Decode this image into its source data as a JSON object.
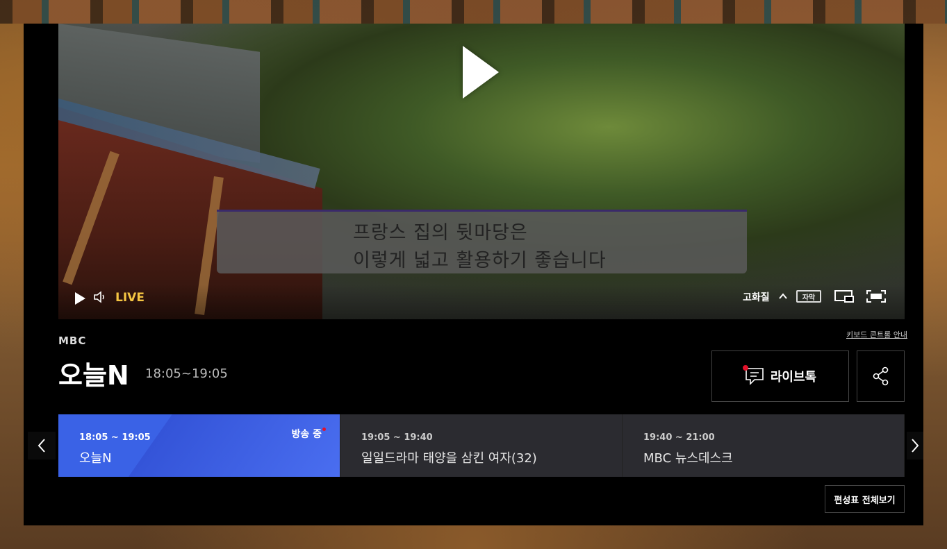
{
  "player": {
    "subtitle_line1": "프랑스 집의 뒷마당은",
    "subtitle_line2": "이렇게 넓고 활용하기 좋습니다",
    "live_label": "LIVE",
    "quality_label": "고화질",
    "cc_label": "자막"
  },
  "program": {
    "keyboard_help": "키보드 콘트롤 안내",
    "channel": "MBC",
    "title": "오늘N",
    "time": "18:05~19:05",
    "live_talk_label": "라이브톡"
  },
  "schedule": {
    "items": [
      {
        "time": "18:05 ~ 19:05",
        "title": "오늘N",
        "status": "방송 중"
      },
      {
        "time": "19:05 ~ 19:40",
        "title": "일일드라마 태양을 삼킨 여자(32)"
      },
      {
        "time": "19:40 ~ 21:00",
        "title": "MBC 뉴스데스크"
      }
    ],
    "full_schedule_label": "편성표 전체보기"
  },
  "colors": {
    "live": "#f5c542",
    "active_schedule": "#3a62e6",
    "badge_dot": "#e3112a"
  }
}
